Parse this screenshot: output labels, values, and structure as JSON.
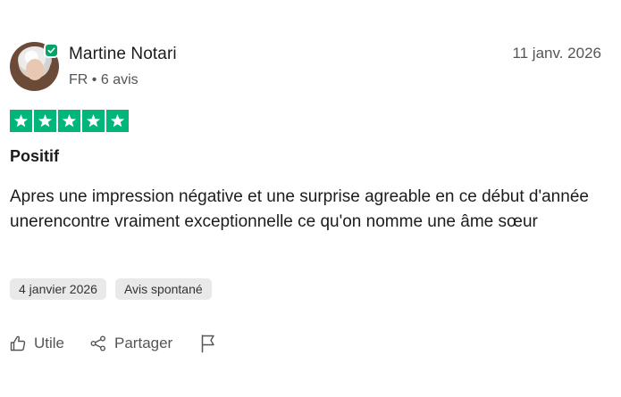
{
  "reviewer": {
    "name": "Martine Notari",
    "country": "FR",
    "separator": "•",
    "review_count": "6 avis"
  },
  "review": {
    "date": "11 janv. 2026",
    "rating": 5,
    "rating_color": "#00b67a",
    "title": "Positif",
    "body": "Apres une impression négative et une surprise agreable en ce début d'année unerencontre vraiment exceptionnelle ce qu'on nomme une âme sœur",
    "experience_date": "4 janvier 2026",
    "source_tag": "Avis spontané"
  },
  "actions": {
    "useful_label": "Utile",
    "share_label": "Partager",
    "useful_icon": "thumbs-up-icon",
    "share_icon": "share-icon",
    "report_icon": "flag-icon"
  },
  "colors": {
    "verified_badge": "#04a36a",
    "tag_background": "#e9e9e9"
  }
}
